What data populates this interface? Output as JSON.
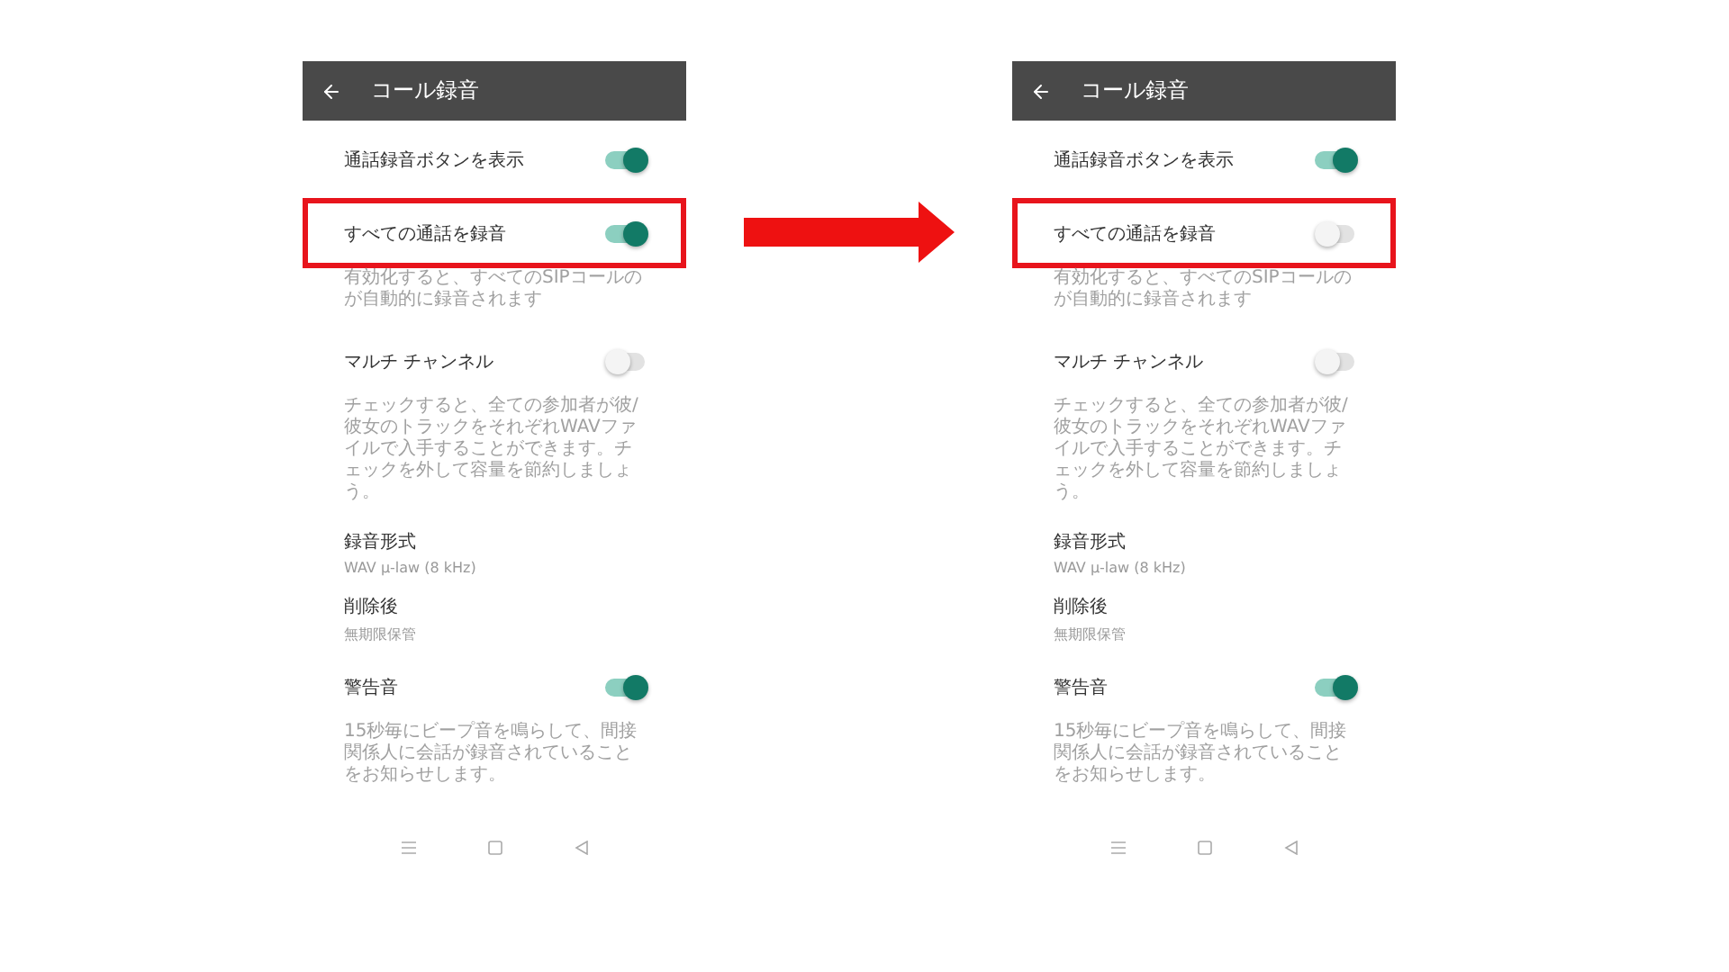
{
  "screens": [
    {
      "title": "コール録音",
      "items": [
        {
          "kind": "toggle",
          "title": "通話録音ボタンを表示",
          "on": true,
          "highlighted": false
        },
        {
          "kind": "toggle",
          "title": "すべての通話を録音",
          "on": true,
          "highlighted": true,
          "description": "有効化すると、すべてのSIPコールのが自動的に録音されます"
        },
        {
          "kind": "toggle",
          "title": "マルチ チャンネル",
          "on": false,
          "highlighted": false,
          "description": "チェックすると、全ての参加者が彼/彼女のトラックをそれぞれWAVファイルで入手することができます。チェックを外して容量を節約しましょう。"
        },
        {
          "kind": "value",
          "title": "録音形式",
          "value": "WAV µ-law (8 kHz)"
        },
        {
          "kind": "value",
          "title": "削除後",
          "value": "無期限保管"
        },
        {
          "kind": "toggle",
          "title": "警告音",
          "on": true,
          "highlighted": false,
          "description": "15秒毎にビープ音を鳴らして、間接関係人に会話が録音されていることをお知らせします。"
        }
      ]
    },
    {
      "title": "コール録音",
      "items": [
        {
          "kind": "toggle",
          "title": "通話録音ボタンを表示",
          "on": true,
          "highlighted": false
        },
        {
          "kind": "toggle",
          "title": "すべての通話を録音",
          "on": false,
          "highlighted": true,
          "description": "有効化すると、すべてのSIPコールのが自動的に録音されます"
        },
        {
          "kind": "toggle",
          "title": "マルチ チャンネル",
          "on": false,
          "highlighted": false,
          "description": "チェックすると、全ての参加者が彼/彼女のトラックをそれぞれWAVファイルで入手することができます。チェックを外して容量を節約しましょう。"
        },
        {
          "kind": "value",
          "title": "録音形式",
          "value": "WAV µ-law (8 kHz)"
        },
        {
          "kind": "value",
          "title": "削除後",
          "value": "無期限保管"
        },
        {
          "kind": "toggle",
          "title": "警告音",
          "on": true,
          "highlighted": false,
          "description": "15秒毎にビープ音を鳴らして、間接関係人に会話が録音されていることをお知らせします。"
        }
      ]
    }
  ]
}
